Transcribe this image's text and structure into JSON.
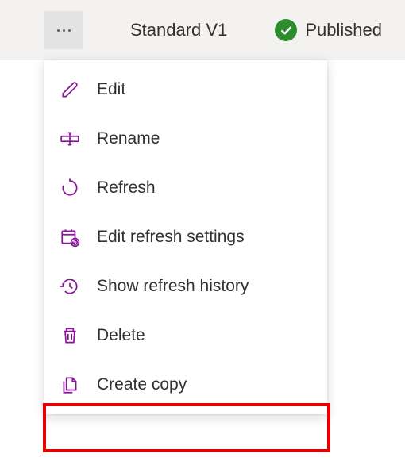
{
  "header": {
    "title": "Standard V1",
    "status_label": "Published"
  },
  "menu": {
    "items": [
      {
        "label": "Edit",
        "icon": "pencil-icon"
      },
      {
        "label": "Rename",
        "icon": "rename-icon"
      },
      {
        "label": "Refresh",
        "icon": "refresh-icon"
      },
      {
        "label": "Edit refresh settings",
        "icon": "calendar-refresh-icon"
      },
      {
        "label": "Show refresh history",
        "icon": "history-icon"
      },
      {
        "label": "Delete",
        "icon": "trash-icon"
      },
      {
        "label": "Create copy",
        "icon": "copy-icon"
      }
    ]
  },
  "highlighted_item_index": 6
}
